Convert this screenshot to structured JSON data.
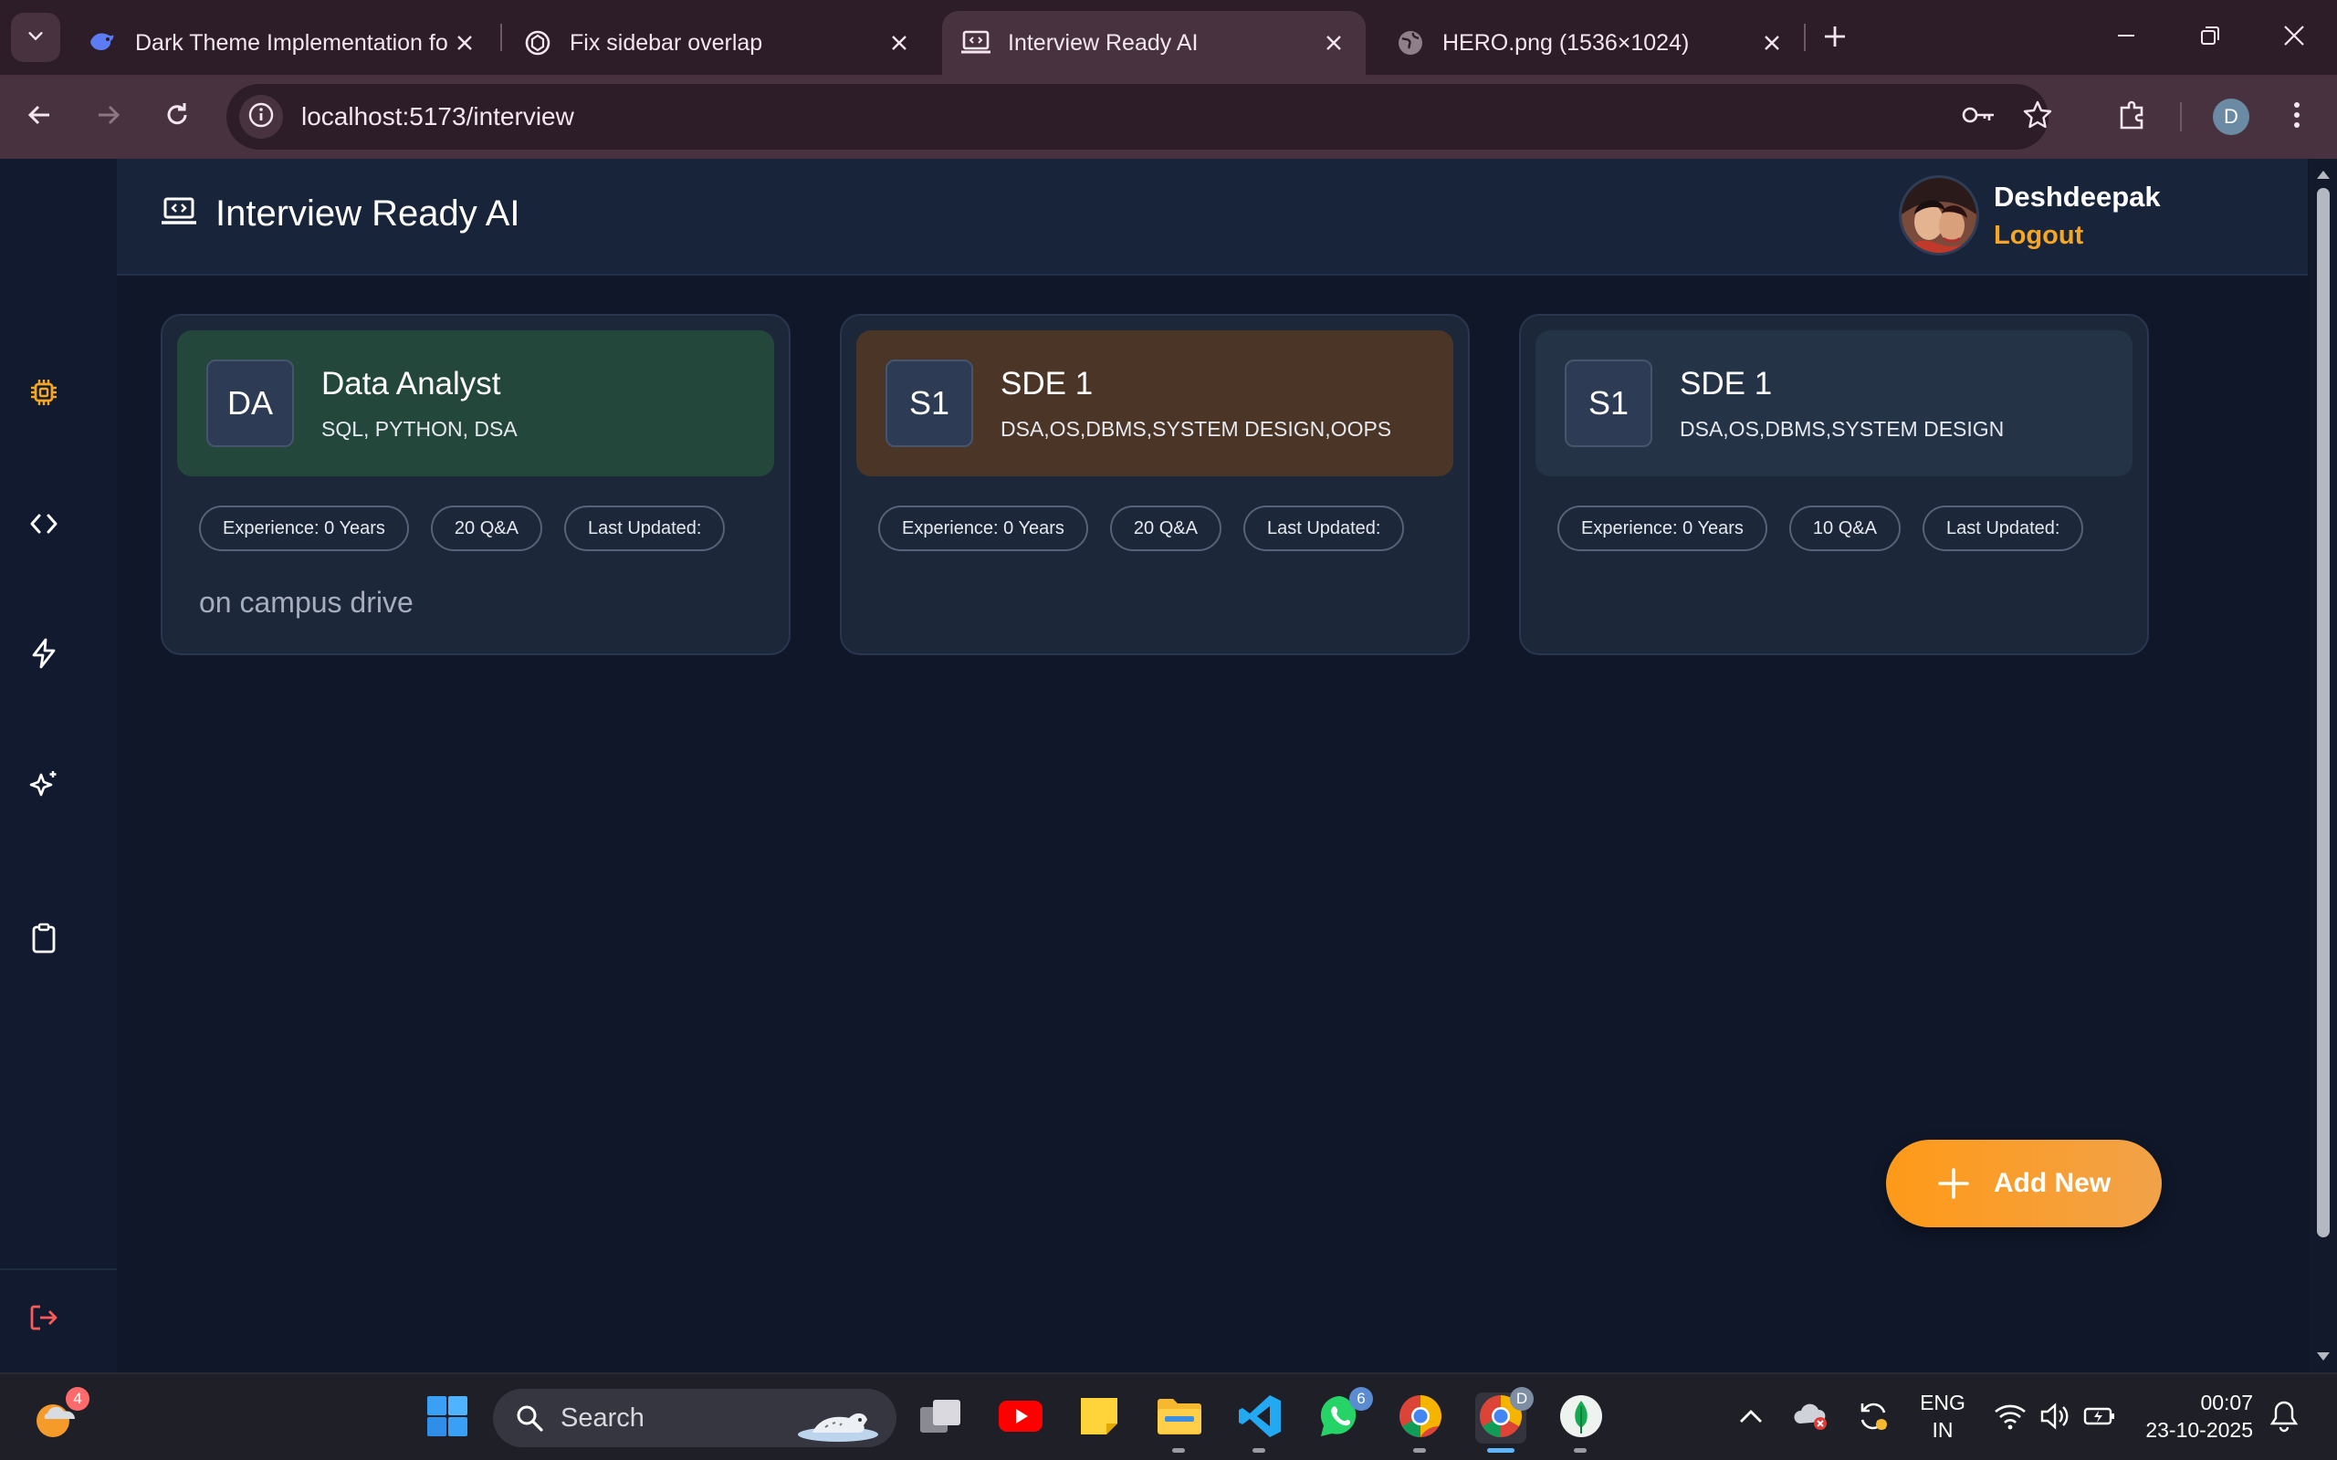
{
  "browser": {
    "tabs": [
      {
        "title": "Dark Theme Implementation fo",
        "favicon": "deepseek-icon",
        "active": false
      },
      {
        "title": "Fix sidebar overlap",
        "favicon": "chatgpt-icon",
        "active": false
      },
      {
        "title": "Interview Ready AI",
        "favicon": "laptop-code-icon",
        "active": true
      },
      {
        "title": "HERO.png (1536×1024)",
        "favicon": "globe-icon",
        "active": false
      }
    ],
    "url": "localhost:5173/interview",
    "profile_initial": "D"
  },
  "app": {
    "title": "Interview Ready AI",
    "user": {
      "name": "Deshdeepak",
      "logout_label": "Logout"
    },
    "sidebar_icons": [
      "cpu-icon",
      "code-icon",
      "lightning-icon",
      "sparkles-icon",
      "clipboard-icon"
    ],
    "sidebar_active_color": "#f5a623",
    "logout_icon_color": "#ff5a5a",
    "cards": [
      {
        "initials": "DA",
        "title": "Data Analyst",
        "skills": "SQL, PYTHON, DSA",
        "experience": "Experience: 0 Years",
        "qa": "20 Q&A",
        "updated": "Last Updated:",
        "description": "on campus drive",
        "accent": "#24473c"
      },
      {
        "initials": "S1",
        "title": "SDE 1",
        "skills": "DSA,OS,DBMS,SYSTEM DESIGN,OOPS",
        "experience": "Experience: 0 Years",
        "qa": "20 Q&A",
        "updated": "Last Updated:",
        "description": "",
        "accent": "#4a3527"
      },
      {
        "initials": "S1",
        "title": "SDE 1",
        "skills": "DSA,OS,DBMS,SYSTEM DESIGN",
        "experience": "Experience: 0 Years",
        "qa": "10 Q&A",
        "updated": "Last Updated:",
        "description": "",
        "accent": "#243346"
      }
    ],
    "add_new_label": "Add New",
    "accent_color": "#ff9a18"
  },
  "taskbar": {
    "search_placeholder": "Search",
    "weather_badge": "4",
    "whatsapp_badge": "6",
    "chrome_profile_badge": "D",
    "lang_line1": "ENG",
    "lang_line2": "IN",
    "time": "00:07",
    "date": "23-10-2025"
  }
}
